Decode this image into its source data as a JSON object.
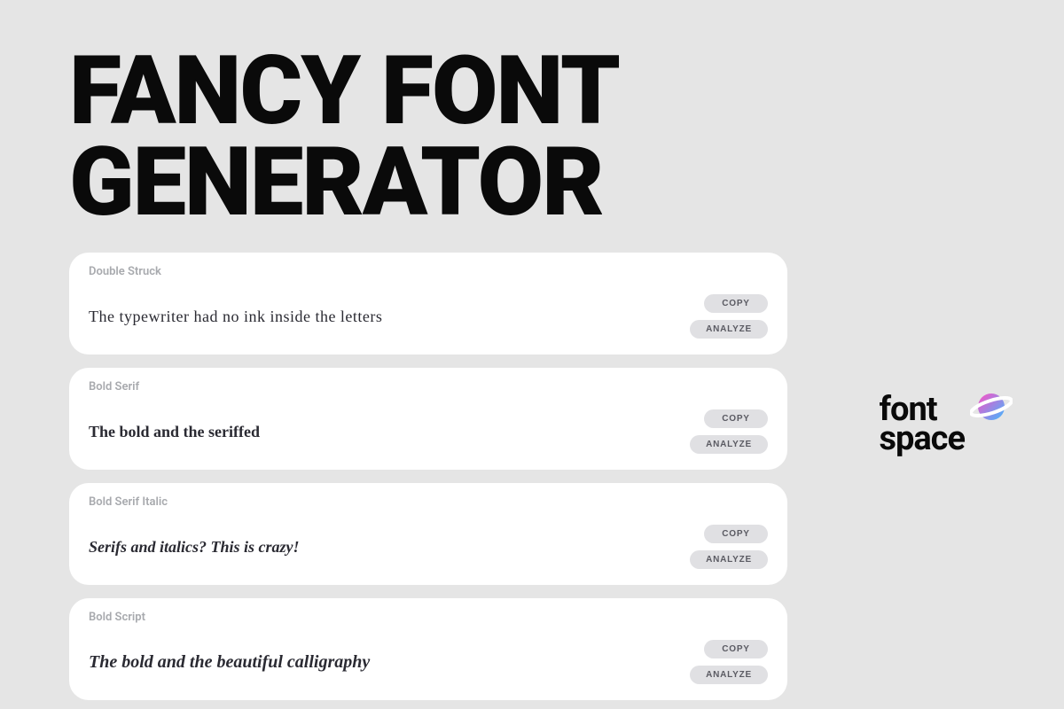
{
  "title": "FANCY FONT GENERATOR",
  "cards": [
    {
      "label": "Double Struck",
      "text": "The typewriter had no ink inside the letters",
      "copy_label": "COPY",
      "analyze_label": "ANALYZE"
    },
    {
      "label": "Bold Serif",
      "text": "The bold and the seriffed",
      "copy_label": "COPY",
      "analyze_label": "ANALYZE"
    },
    {
      "label": "Bold Serif Italic",
      "text": "Serifs and italics? This is crazy!",
      "copy_label": "COPY",
      "analyze_label": "ANALYZE"
    },
    {
      "label": "Bold Script",
      "text": "The bold and the beautiful calligraphy",
      "copy_label": "COPY",
      "analyze_label": "ANALYZE"
    }
  ],
  "brand": {
    "line1": "font",
    "line2": "space",
    "icon": "planet-icon"
  }
}
